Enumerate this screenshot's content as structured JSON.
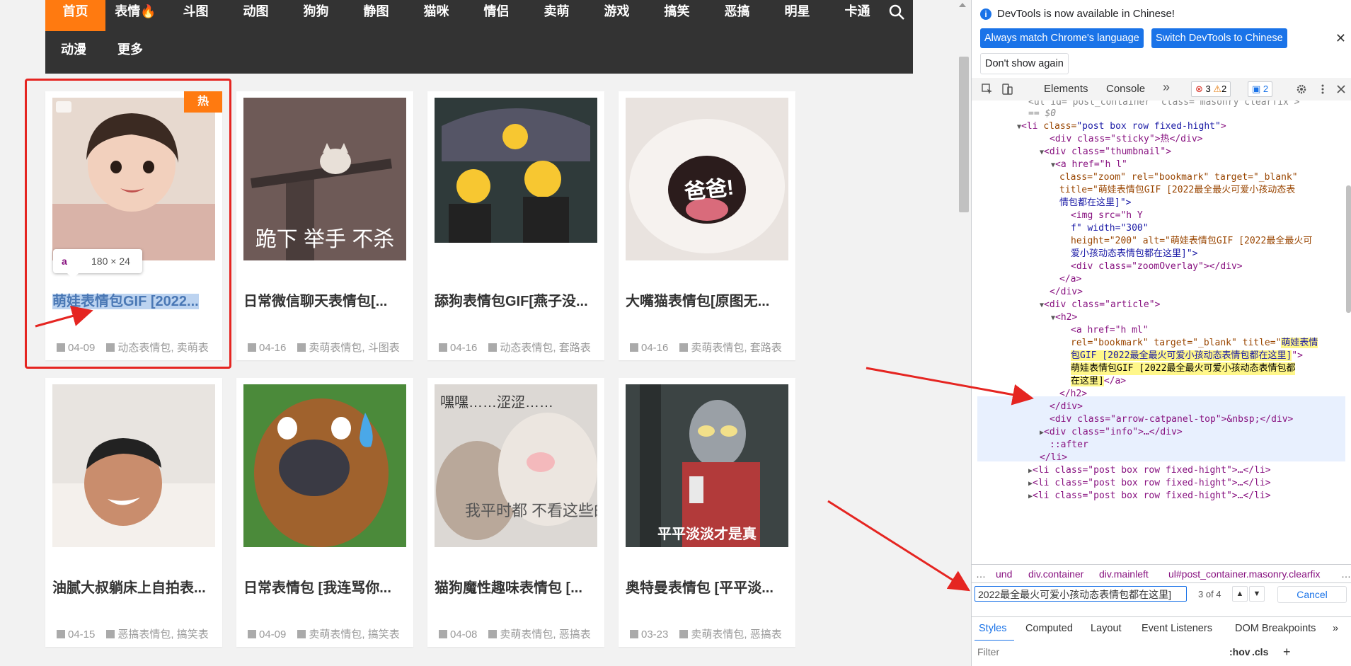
{
  "nav": {
    "row1": [
      "首页",
      "表情🔥",
      "斗图",
      "动图",
      "狗狗",
      "静图",
      "猫咪",
      "情侣",
      "卖萌",
      "游戏",
      "搞笑",
      "恶搞",
      "明星",
      "卡通"
    ],
    "row2": [
      "动漫",
      "更多"
    ]
  },
  "cards": [
    {
      "title": "萌娃表情包GIF [2022...",
      "date": "04-09",
      "tags": "动态表情包, 卖萌表",
      "sticky": "热"
    },
    {
      "title": "日常微信聊天表情包[...",
      "date": "04-16",
      "tags": "卖萌表情包, 斗图表",
      "caption": "跪下 举手 不杀"
    },
    {
      "title": "舔狗表情包GIF[燕子没...",
      "date": "04-16",
      "tags": "动态表情包, 套路表"
    },
    {
      "title": "大嘴猫表情包[原图无...",
      "date": "04-16",
      "tags": "卖萌表情包, 套路表",
      "caption": "爸爸!"
    },
    {
      "title": "油腻大叔躺床上自拍表...",
      "date": "04-15",
      "tags": "恶搞表情包, 搞笑表"
    },
    {
      "title": "日常表情包 [我连骂你...",
      "date": "04-09",
      "tags": "卖萌表情包, 搞笑表"
    },
    {
      "title": "猫狗魔性趣味表情包 [...",
      "date": "04-08",
      "tags": "卖萌表情包, 恶搞表",
      "caption": "我平时都\n不看这些的",
      "caption_top": "嘿嘿……涩涩……"
    },
    {
      "title": "奥特曼表情包 [平平淡...",
      "date": "03-23",
      "tags": "卖萌表情包, 恶搞表",
      "caption": "平平淡淡才是真"
    }
  ],
  "tooltip": {
    "tag": "a",
    "dims": "180 × 24"
  },
  "devtools": {
    "banner_msg": "DevTools is now available in Chinese!",
    "btn_match": "Always match Chrome's language",
    "btn_switch": "Switch DevTools to Chinese",
    "btn_dont": "Don't show again",
    "tabs": {
      "elements": "Elements",
      "console": "Console"
    },
    "issues": {
      "errors": "3",
      "warnings": "2",
      "messages": "2"
    },
    "dom": {
      "l0": "== $0",
      "l1_tag": "<li ",
      "l1_attr": "class=",
      "l1_val": "\"post box row fixed-hight\"",
      "l1_end": ">",
      "l2": "<div class=\"sticky\">热</div>",
      "l3": "<div class=\"thumbnail\">",
      "l4": "<a href=\"h                          l\"",
      "l5": "class=\"zoom\" rel=\"bookmark\" target=\"_blank\"",
      "l6": "title=\"萌娃表情包GIF [2022最全最火可爱小孩动态表",
      "l7": "情包都在这里]\">",
      "l8": "<img src=\"h                               Y",
      "l9": "                          f\" width=\"300\"",
      "l10": "height=\"200\" alt=\"萌娃表情包GIF [2022最全最火可",
      "l11": "爱小孩动态表情包都在这里]\">",
      "l12": "<div class=\"zoomOverlay\"></div>",
      "l13": "</a>",
      "l14": "</div>",
      "l15": "<div class=\"article\">",
      "l16": "<h2>",
      "l17": "<a href=\"h                          ml\"",
      "l18a": "rel=\"bookmark\" target=\"_blank\" title=\"",
      "l18b": "萌娃表情",
      "l19": "包GIF [2022最全最火可爱小孩动态表情包都在这里]",
      "l19end": "\">",
      "l20": "萌娃表情包GIF [2022最全最火可爱小孩动态表情包都",
      "l21a": "在这里]",
      "l21b": "</a>",
      "l22": "</h2>",
      "l23": "</div>",
      "l24": "<div class=\"arrow-catpanel-top\">&nbsp;</div>",
      "l25": "<div class=\"info\">…</div>",
      "l26": "::after",
      "l27": "</li>",
      "l28": "<li class=\"post box row fixed-hight\">…</li>",
      "l29": "<li class=\"post box row fixed-hight\">…</li>",
      "l30": "<li class=\"post box row fixed-hight\">…</li>",
      "top": "<ul id=\"post_container\" class=\"masonry clearfix\">"
    },
    "breadcrumbs": [
      "…",
      "und",
      "div.container",
      "div.mainleft",
      "ul#post_container.masonry.clearfix",
      "…"
    ],
    "search": {
      "value": "2022最全最火可爱小孩动态表情包都在这里]",
      "count": "3 of 4",
      "cancel": "Cancel"
    },
    "style_tabs": [
      "Styles",
      "Computed",
      "Layout",
      "Event Listeners",
      "DOM Breakpoints"
    ],
    "filter": {
      "placeholder": "Filter",
      "hov": ":hov",
      ".cls": ".cls",
      "cls": ".cls"
    }
  }
}
